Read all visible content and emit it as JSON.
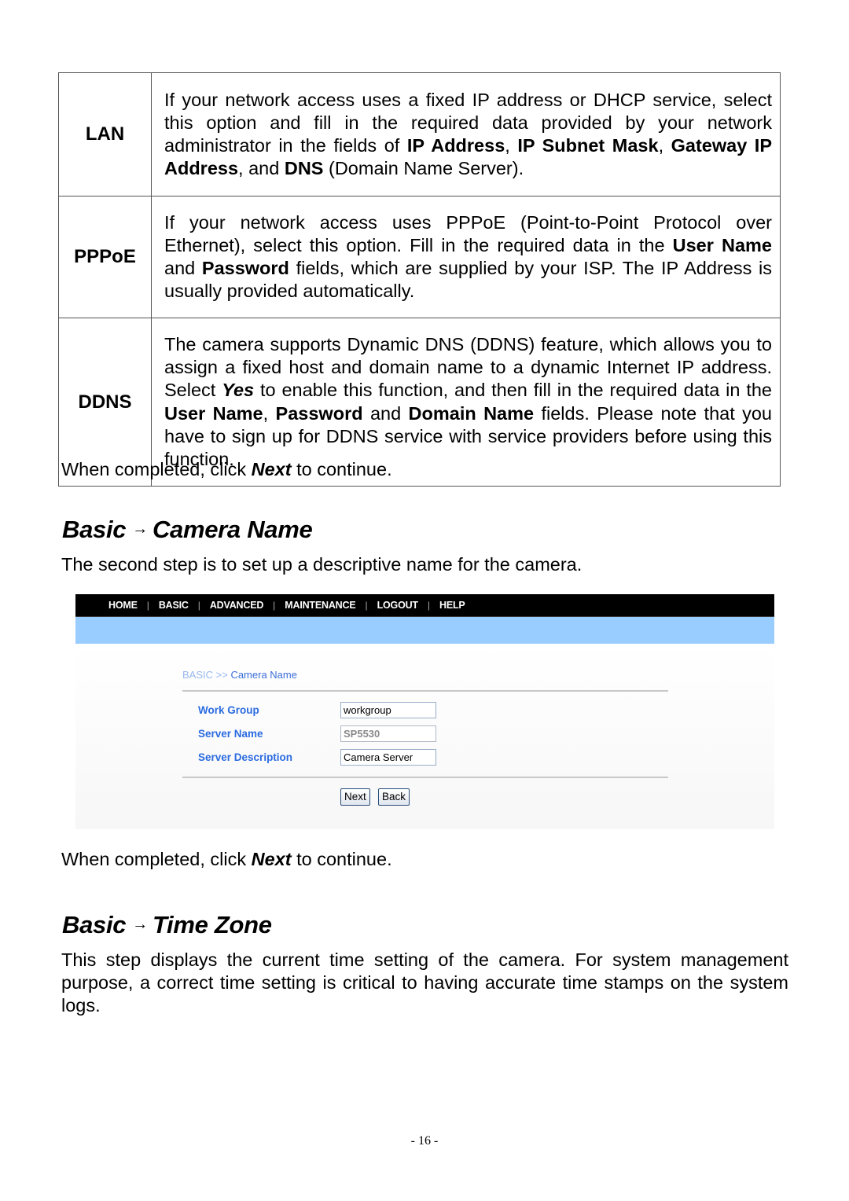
{
  "options_table": {
    "rows": [
      {
        "term": "LAN",
        "desc": [
          {
            "t": "If your network access uses a fixed IP address or DHCP service, select this option and fill in the required data provided by your network administrator in the fields of ",
            "b": false
          },
          {
            "t": "IP Address",
            "b": true
          },
          {
            "t": ", ",
            "b": false
          },
          {
            "t": "IP Subnet Mask",
            "b": true
          },
          {
            "t": ", ",
            "b": false
          },
          {
            "t": "Gateway IP Address",
            "b": true
          },
          {
            "t": ", and ",
            "b": false
          },
          {
            "t": "DNS",
            "b": true
          },
          {
            "t": " (Domain Name Server).",
            "b": false
          }
        ]
      },
      {
        "term": "PPPoE",
        "desc": [
          {
            "t": "If your network access uses PPPoE (Point-to-Point Protocol over Ethernet), select this option.  Fill in the required data in the ",
            "b": false
          },
          {
            "t": "User Name",
            "b": true
          },
          {
            "t": " and ",
            "b": false
          },
          {
            "t": "Password",
            "b": true
          },
          {
            "t": " fields, which are supplied by your ISP.  The IP Address is usually provided automatically.",
            "b": false
          }
        ]
      },
      {
        "term": "DDNS",
        "desc": [
          {
            "t": "The camera supports Dynamic DNS (DDNS) feature, which allows you to assign a fixed host and domain name to a dynamic Internet IP address.  Select ",
            "b": false
          },
          {
            "t": "Yes",
            "b": true,
            "i": true
          },
          {
            "t": " to enable this function, and then fill in the required data in the ",
            "b": false
          },
          {
            "t": "User Name",
            "b": true
          },
          {
            "t": ", ",
            "b": false
          },
          {
            "t": "Password",
            "b": true
          },
          {
            "t": " and ",
            "b": false
          },
          {
            "t": "Domain Name",
            "b": true
          },
          {
            "t": " fields.  Please note that you have to sign up for DDNS service with service providers before using this function.",
            "b": false
          }
        ]
      }
    ]
  },
  "completed_1": {
    "pre": "When completed, click ",
    "em": "Next",
    "post": " to continue."
  },
  "section_camera_name": {
    "heading_left": "Basic",
    "arrow": "→",
    "heading_right": "Camera Name",
    "intro": "The second step is to set up a descriptive name for the camera."
  },
  "screenshot": {
    "nav": [
      "HOME",
      "BASIC",
      "ADVANCED",
      "MAINTENANCE",
      "LOGOUT",
      "HELP"
    ],
    "nav_sep": "|",
    "breadcrumb_root": "BASIC",
    "breadcrumb_sep": " >> ",
    "breadcrumb_page": "Camera Name",
    "fields": [
      {
        "label": "Work Group",
        "value": "workgroup",
        "disabled": false
      },
      {
        "label": "Server Name",
        "value": "SP5530",
        "disabled": true
      },
      {
        "label": "Server Description",
        "value": "Camera Server",
        "disabled": false
      }
    ],
    "next_label": "Next",
    "back_label": "Back",
    "colors": {
      "navbar": "#000000",
      "banner": "#99ccff",
      "label": "#2a6be0",
      "crumb_root": "#99b8ee",
      "crumb_page": "#3b6fd8"
    }
  },
  "completed_2": {
    "pre": "When completed, click ",
    "em": "Next",
    "post": " to continue."
  },
  "section_time_zone": {
    "heading_left": "Basic",
    "arrow": "→",
    "heading_right": "Time Zone",
    "intro": "This step displays the current time setting of the camera.  For system management purpose, a correct time setting is critical to having accurate time stamps on the system logs."
  },
  "page_number": "- 16 -"
}
